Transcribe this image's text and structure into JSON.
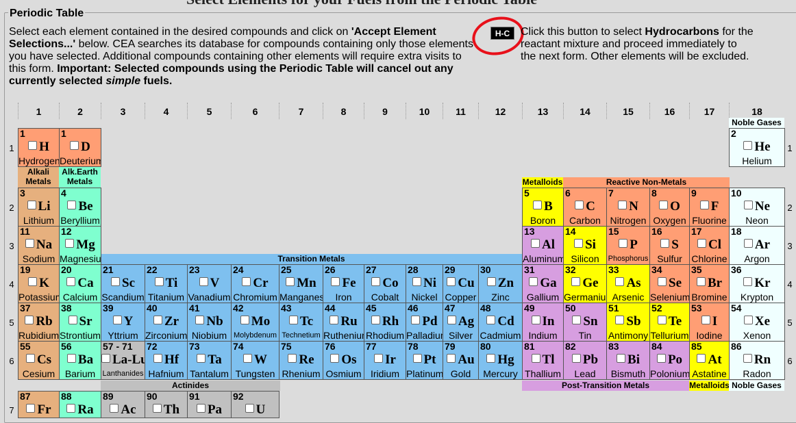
{
  "page": {
    "top_title": "Select Elements for your Fuels from the Periodic Table",
    "legend": "Periodic Table",
    "instructions": {
      "p1": "Select each element contained in the desired compounds and click on ",
      "accept": "'Accept Element Selections...'",
      "p2": " below. CEA searches its database for compounds containing only those elements you have selected. Additional compounds containing other elements will require extra visits to this form. ",
      "important": "Important: Selected compounds using the Periodic Table will cancel out any currently selected ",
      "simple": "simple",
      "fuels": " fuels."
    },
    "hc_button": "H-C",
    "hc_text": {
      "p1": "Click this button to select ",
      "bold": "Hydrocarbons",
      "p2": " for the reactant mixture and proceed immediately to the next form. Other elements will be excluded."
    }
  },
  "colors": {
    "alkali": "#e6b07e",
    "alkaline_earth": "#7fffcf",
    "transition": "#7ec0ef",
    "post_transition": "#d79ee0",
    "metalloid": "#ffff00",
    "nonmetal": "#ff9e74",
    "noble": "#f0ffff",
    "lan_act": "#c0c0c0"
  },
  "column_numbers": [
    "1",
    "2",
    "3",
    "4",
    "5",
    "6",
    "7",
    "8",
    "9",
    "10",
    "11",
    "12",
    "13",
    "14",
    "15",
    "16",
    "17",
    "18"
  ],
  "row_numbers": [
    "1",
    "2",
    "3",
    "4",
    "5",
    "6",
    "7"
  ],
  "band_labels": {
    "noble_gases": "Noble Gases",
    "alkali": "Alkali Metals",
    "alkaline_earth": "Alk.Earth Metals",
    "metalloids": "Metalloids",
    "reactive_nonmetals": "Reactive Non-Metals",
    "transition": "Transition Metals",
    "actinides": "Actinides",
    "post_transition": "Post-Transition Metals",
    "metalloids_bottom": "Metalloids",
    "noble_bottom": "Noble Gases"
  },
  "elements": [
    {
      "n": "1",
      "s": "H",
      "name": "Hydrogen",
      "col": 1,
      "row": 1,
      "cat": "nonmet"
    },
    {
      "n": "1",
      "s": "D",
      "name": "Deuterium",
      "col": 2,
      "row": 1,
      "cat": "nonmet"
    },
    {
      "n": "2",
      "s": "He",
      "name": "Helium",
      "col": 18,
      "row": 1,
      "cat": "noble"
    },
    {
      "n": "3",
      "s": "Li",
      "name": "Lithium",
      "col": 1,
      "row": 2,
      "cat": "alkali"
    },
    {
      "n": "4",
      "s": "Be",
      "name": "Beryllium",
      "col": 2,
      "row": 2,
      "cat": "alkear"
    },
    {
      "n": "5",
      "s": "B",
      "name": "Boron",
      "col": 13,
      "row": 2,
      "cat": "metal"
    },
    {
      "n": "6",
      "s": "C",
      "name": "Carbon",
      "col": 14,
      "row": 2,
      "cat": "nonmet"
    },
    {
      "n": "7",
      "s": "N",
      "name": "Nitrogen",
      "col": 15,
      "row": 2,
      "cat": "nonmet"
    },
    {
      "n": "8",
      "s": "O",
      "name": "Oxygen",
      "col": 16,
      "row": 2,
      "cat": "nonmet"
    },
    {
      "n": "9",
      "s": "F",
      "name": "Fluorine",
      "col": 17,
      "row": 2,
      "cat": "nonmet"
    },
    {
      "n": "10",
      "s": "Ne",
      "name": "Neon",
      "col": 18,
      "row": 2,
      "cat": "noble"
    },
    {
      "n": "11",
      "s": "Na",
      "name": "Sodium",
      "col": 1,
      "row": 3,
      "cat": "alkali"
    },
    {
      "n": "12",
      "s": "Mg",
      "name": "Magnesium",
      "col": 2,
      "row": 3,
      "cat": "alkear"
    },
    {
      "n": "13",
      "s": "Al",
      "name": "Aluminum",
      "col": 13,
      "row": 3,
      "cat": "post"
    },
    {
      "n": "14",
      "s": "Si",
      "name": "Silicon",
      "col": 14,
      "row": 3,
      "cat": "metal"
    },
    {
      "n": "15",
      "s": "P",
      "name": "Phosphorus",
      "col": 15,
      "row": 3,
      "cat": "nonmet"
    },
    {
      "n": "16",
      "s": "S",
      "name": "Sulfur",
      "col": 16,
      "row": 3,
      "cat": "nonmet"
    },
    {
      "n": "17",
      "s": "Cl",
      "name": "Chlorine",
      "col": 17,
      "row": 3,
      "cat": "nonmet"
    },
    {
      "n": "18",
      "s": "Ar",
      "name": "Argon",
      "col": 18,
      "row": 3,
      "cat": "noble"
    },
    {
      "n": "19",
      "s": "K",
      "name": "Potassium",
      "col": 1,
      "row": 4,
      "cat": "alkali"
    },
    {
      "n": "20",
      "s": "Ca",
      "name": "Calcium",
      "col": 2,
      "row": 4,
      "cat": "alkear"
    },
    {
      "n": "21",
      "s": "Sc",
      "name": "Scandium",
      "col": 3,
      "row": 4,
      "cat": "trans"
    },
    {
      "n": "22",
      "s": "Ti",
      "name": "Titanium",
      "col": 4,
      "row": 4,
      "cat": "trans"
    },
    {
      "n": "23",
      "s": "V",
      "name": "Vanadium",
      "col": 5,
      "row": 4,
      "cat": "trans"
    },
    {
      "n": "24",
      "s": "Cr",
      "name": "Chromium",
      "col": 6,
      "row": 4,
      "cat": "trans"
    },
    {
      "n": "25",
      "s": "Mn",
      "name": "Manganese",
      "col": 7,
      "row": 4,
      "cat": "trans"
    },
    {
      "n": "26",
      "s": "Fe",
      "name": "Iron",
      "col": 8,
      "row": 4,
      "cat": "trans"
    },
    {
      "n": "27",
      "s": "Co",
      "name": "Cobalt",
      "col": 9,
      "row": 4,
      "cat": "trans"
    },
    {
      "n": "28",
      "s": "Ni",
      "name": "Nickel",
      "col": 10,
      "row": 4,
      "cat": "trans"
    },
    {
      "n": "29",
      "s": "Cu",
      "name": "Copper",
      "col": 11,
      "row": 4,
      "cat": "trans"
    },
    {
      "n": "30",
      "s": "Zn",
      "name": "Zinc",
      "col": 12,
      "row": 4,
      "cat": "trans"
    },
    {
      "n": "31",
      "s": "Ga",
      "name": "Gallium",
      "col": 13,
      "row": 4,
      "cat": "post"
    },
    {
      "n": "32",
      "s": "Ge",
      "name": "Germanium",
      "col": 14,
      "row": 4,
      "cat": "metal"
    },
    {
      "n": "33",
      "s": "As",
      "name": "Arsenic",
      "col": 15,
      "row": 4,
      "cat": "metal"
    },
    {
      "n": "34",
      "s": "Se",
      "name": "Selenium",
      "col": 16,
      "row": 4,
      "cat": "nonmet"
    },
    {
      "n": "35",
      "s": "Br",
      "name": "Bromine",
      "col": 17,
      "row": 4,
      "cat": "nonmet"
    },
    {
      "n": "36",
      "s": "Kr",
      "name": "Krypton",
      "col": 18,
      "row": 4,
      "cat": "noble"
    },
    {
      "n": "37",
      "s": "Rb",
      "name": "Rubidium",
      "col": 1,
      "row": 5,
      "cat": "alkali"
    },
    {
      "n": "38",
      "s": "Sr",
      "name": "Strontium",
      "col": 2,
      "row": 5,
      "cat": "alkear"
    },
    {
      "n": "39",
      "s": "Y",
      "name": "Yttrium",
      "col": 3,
      "row": 5,
      "cat": "trans"
    },
    {
      "n": "40",
      "s": "Zr",
      "name": "Zirconium",
      "col": 4,
      "row": 5,
      "cat": "trans"
    },
    {
      "n": "41",
      "s": "Nb",
      "name": "Niobium",
      "col": 5,
      "row": 5,
      "cat": "trans"
    },
    {
      "n": "42",
      "s": "Mo",
      "name": "Molybdenum",
      "col": 6,
      "row": 5,
      "cat": "trans"
    },
    {
      "n": "43",
      "s": "Tc",
      "name": "Technetium",
      "col": 7,
      "row": 5,
      "cat": "trans"
    },
    {
      "n": "44",
      "s": "Ru",
      "name": "Ruthenium",
      "col": 8,
      "row": 5,
      "cat": "trans"
    },
    {
      "n": "45",
      "s": "Rh",
      "name": "Rhodium",
      "col": 9,
      "row": 5,
      "cat": "trans"
    },
    {
      "n": "46",
      "s": "Pd",
      "name": "Palladium",
      "col": 10,
      "row": 5,
      "cat": "trans"
    },
    {
      "n": "47",
      "s": "Ag",
      "name": "Silver",
      "col": 11,
      "row": 5,
      "cat": "trans"
    },
    {
      "n": "48",
      "s": "Cd",
      "name": "Cadmium",
      "col": 12,
      "row": 5,
      "cat": "trans"
    },
    {
      "n": "49",
      "s": "In",
      "name": "Indium",
      "col": 13,
      "row": 5,
      "cat": "post"
    },
    {
      "n": "50",
      "s": "Sn",
      "name": "Tin",
      "col": 14,
      "row": 5,
      "cat": "post"
    },
    {
      "n": "51",
      "s": "Sb",
      "name": "Antimony",
      "col": 15,
      "row": 5,
      "cat": "metal"
    },
    {
      "n": "52",
      "s": "Te",
      "name": "Tellurium",
      "col": 16,
      "row": 5,
      "cat": "metal"
    },
    {
      "n": "53",
      "s": "I",
      "name": "Iodine",
      "col": 17,
      "row": 5,
      "cat": "nonmet"
    },
    {
      "n": "54",
      "s": "Xe",
      "name": "Xenon",
      "col": 18,
      "row": 5,
      "cat": "noble"
    },
    {
      "n": "55",
      "s": "Cs",
      "name": "Cesium",
      "col": 1,
      "row": 6,
      "cat": "alkali"
    },
    {
      "n": "56",
      "s": "Ba",
      "name": "Barium",
      "col": 2,
      "row": 6,
      "cat": "alkear"
    },
    {
      "n": "57 - 71",
      "s": "La-Lu",
      "name": "Lanthanides",
      "col": 3,
      "row": 6,
      "cat": "lanac"
    },
    {
      "n": "72",
      "s": "Hf",
      "name": "Hafnium",
      "col": 4,
      "row": 6,
      "cat": "trans"
    },
    {
      "n": "73",
      "s": "Ta",
      "name": "Tantalum",
      "col": 5,
      "row": 6,
      "cat": "trans"
    },
    {
      "n": "74",
      "s": "W",
      "name": "Tungsten",
      "col": 6,
      "row": 6,
      "cat": "trans"
    },
    {
      "n": "75",
      "s": "Re",
      "name": "Rhenium",
      "col": 7,
      "row": 6,
      "cat": "trans"
    },
    {
      "n": "76",
      "s": "Os",
      "name": "Osmium",
      "col": 8,
      "row": 6,
      "cat": "trans"
    },
    {
      "n": "77",
      "s": "Ir",
      "name": "Iridium",
      "col": 9,
      "row": 6,
      "cat": "trans"
    },
    {
      "n": "78",
      "s": "Pt",
      "name": "Platinum",
      "col": 10,
      "row": 6,
      "cat": "trans"
    },
    {
      "n": "79",
      "s": "Au",
      "name": "Gold",
      "col": 11,
      "row": 6,
      "cat": "trans"
    },
    {
      "n": "80",
      "s": "Hg",
      "name": "Mercury",
      "col": 12,
      "row": 6,
      "cat": "trans"
    },
    {
      "n": "81",
      "s": "Tl",
      "name": "Thallium",
      "col": 13,
      "row": 6,
      "cat": "post"
    },
    {
      "n": "82",
      "s": "Pb",
      "name": "Lead",
      "col": 14,
      "row": 6,
      "cat": "post"
    },
    {
      "n": "83",
      "s": "Bi",
      "name": "Bismuth",
      "col": 15,
      "row": 6,
      "cat": "post"
    },
    {
      "n": "84",
      "s": "Po",
      "name": "Polonium",
      "col": 16,
      "row": 6,
      "cat": "post"
    },
    {
      "n": "85",
      "s": "At",
      "name": "Astatine",
      "col": 17,
      "row": 6,
      "cat": "metal"
    },
    {
      "n": "86",
      "s": "Rn",
      "name": "Radon",
      "col": 18,
      "row": 6,
      "cat": "noble"
    },
    {
      "n": "87",
      "s": "Fr",
      "name": "",
      "col": 1,
      "row": 7,
      "cat": "alkali"
    },
    {
      "n": "88",
      "s": "Ra",
      "name": "",
      "col": 2,
      "row": 7,
      "cat": "alkear"
    },
    {
      "n": "89",
      "s": "Ac",
      "name": "",
      "col": 3,
      "row": 7,
      "cat": "lanac"
    },
    {
      "n": "90",
      "s": "Th",
      "name": "",
      "col": 4,
      "row": 7,
      "cat": "lanac"
    },
    {
      "n": "91",
      "s": "Pa",
      "name": "",
      "col": 5,
      "row": 7,
      "cat": "lanac"
    },
    {
      "n": "92",
      "s": "U",
      "name": "",
      "col": 6,
      "row": 7,
      "cat": "lanac"
    }
  ]
}
